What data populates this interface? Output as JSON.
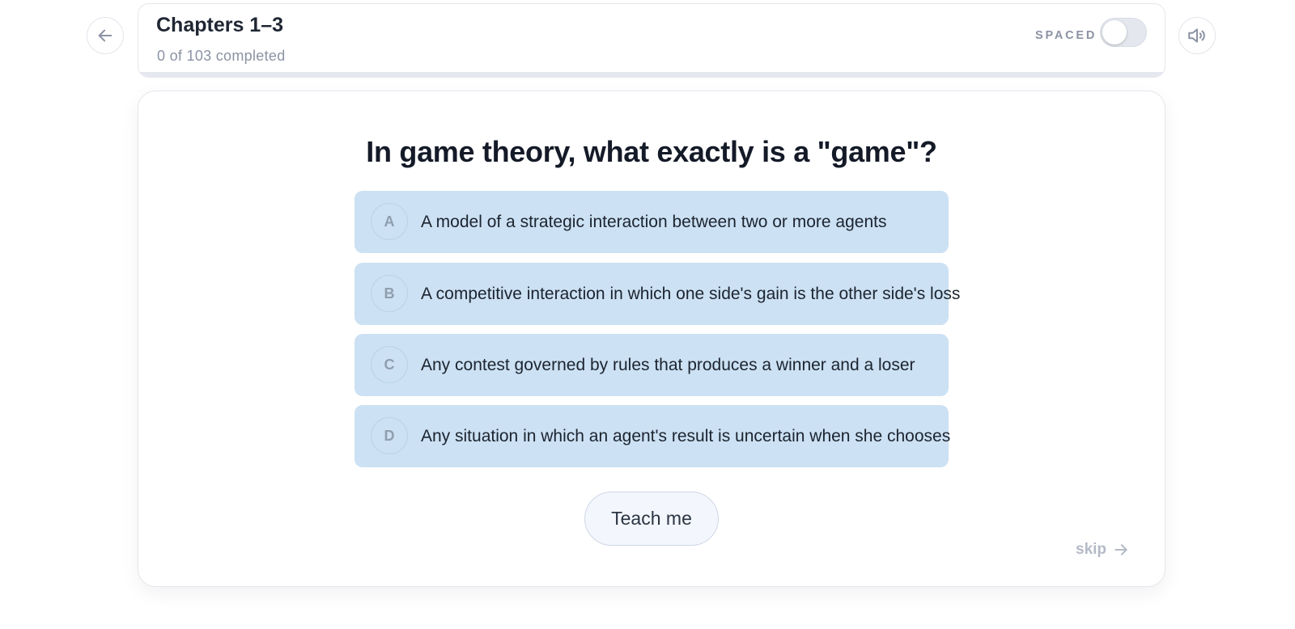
{
  "header": {
    "title": "Chapters 1–3",
    "progress_text": "0 of 103 completed",
    "completed": 0,
    "total": 103,
    "spaced_label": "SPACED",
    "spaced_enabled": false
  },
  "question": {
    "text": "In game theory, what exactly is a \"game\"?",
    "options": [
      {
        "letter": "A",
        "text": "A model of a strategic interaction between two or more agents"
      },
      {
        "letter": "B",
        "text": "A competitive interaction in which one side's gain is the other side's loss"
      },
      {
        "letter": "C",
        "text": "Any contest governed by rules that produces a winner and a loser"
      },
      {
        "letter": "D",
        "text": "Any situation in which an agent's result is uncertain when she chooses"
      }
    ]
  },
  "actions": {
    "teach_label": "Teach me",
    "skip_label": "skip"
  },
  "icons": {
    "back": "arrow-left-icon",
    "sound": "speaker-icon",
    "skip": "arrow-right-icon"
  },
  "colors": {
    "option_bg": "#cce1f3",
    "progress_track": "#e6e8ef"
  }
}
